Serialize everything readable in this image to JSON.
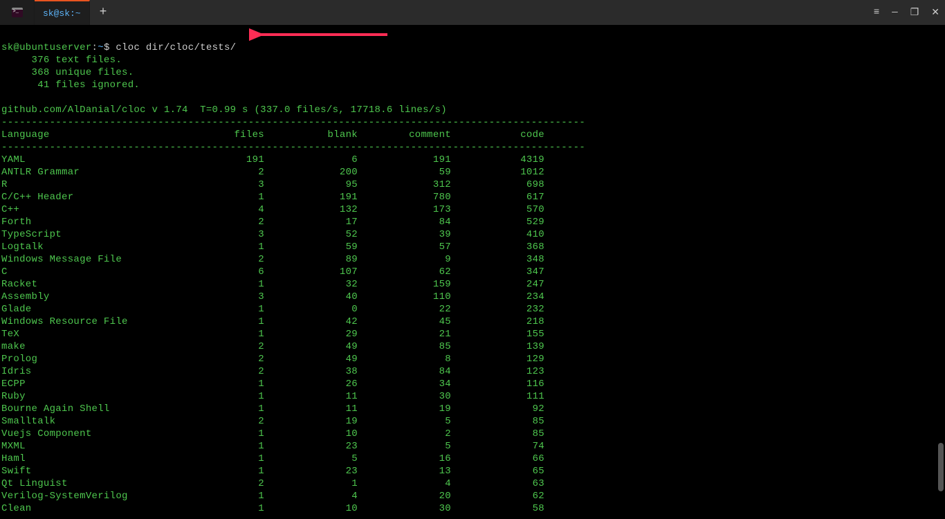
{
  "titlebar": {
    "tab_title": "sk@sk:~",
    "add_label": "+",
    "hamburger": "≡",
    "minimize": "—",
    "maximize": "❐",
    "close": "✕"
  },
  "prompt": {
    "user": "sk@ubuntuserver",
    "colon": ":",
    "path": "~",
    "dollar": "$"
  },
  "command": "cloc dir/cloc/tests/",
  "output_lines": [
    "     376 text files.",
    "     368 unique files.",
    "      41 files ignored."
  ],
  "version_line": "github.com/AlDanial/cloc v 1.74  T=0.99 s (337.0 files/s, 17718.6 lines/s)",
  "dashes": "-------------------------------------------------------------------------------------------------",
  "header": {
    "lang": "Language",
    "files": "files",
    "blank": "blank",
    "comment": "comment",
    "code": "code"
  },
  "chart_data": {
    "type": "table",
    "columns": [
      "Language",
      "files",
      "blank",
      "comment",
      "code"
    ],
    "rows": [
      {
        "lang": "YAML",
        "files": 191,
        "blank": 6,
        "comment": 191,
        "code": 4319
      },
      {
        "lang": "ANTLR Grammar",
        "files": 2,
        "blank": 200,
        "comment": 59,
        "code": 1012
      },
      {
        "lang": "R",
        "files": 3,
        "blank": 95,
        "comment": 312,
        "code": 698
      },
      {
        "lang": "C/C++ Header",
        "files": 1,
        "blank": 191,
        "comment": 780,
        "code": 617
      },
      {
        "lang": "C++",
        "files": 4,
        "blank": 132,
        "comment": 173,
        "code": 570
      },
      {
        "lang": "Forth",
        "files": 2,
        "blank": 17,
        "comment": 84,
        "code": 529
      },
      {
        "lang": "TypeScript",
        "files": 3,
        "blank": 52,
        "comment": 39,
        "code": 410
      },
      {
        "lang": "Logtalk",
        "files": 1,
        "blank": 59,
        "comment": 57,
        "code": 368
      },
      {
        "lang": "Windows Message File",
        "files": 2,
        "blank": 89,
        "comment": 9,
        "code": 348
      },
      {
        "lang": "C",
        "files": 6,
        "blank": 107,
        "comment": 62,
        "code": 347
      },
      {
        "lang": "Racket",
        "files": 1,
        "blank": 32,
        "comment": 159,
        "code": 247
      },
      {
        "lang": "Assembly",
        "files": 3,
        "blank": 40,
        "comment": 110,
        "code": 234
      },
      {
        "lang": "Glade",
        "files": 1,
        "blank": 0,
        "comment": 22,
        "code": 232
      },
      {
        "lang": "Windows Resource File",
        "files": 1,
        "blank": 42,
        "comment": 45,
        "code": 218
      },
      {
        "lang": "TeX",
        "files": 1,
        "blank": 29,
        "comment": 21,
        "code": 155
      },
      {
        "lang": "make",
        "files": 2,
        "blank": 49,
        "comment": 85,
        "code": 139
      },
      {
        "lang": "Prolog",
        "files": 2,
        "blank": 49,
        "comment": 8,
        "code": 129
      },
      {
        "lang": "Idris",
        "files": 2,
        "blank": 38,
        "comment": 84,
        "code": 123
      },
      {
        "lang": "ECPP",
        "files": 1,
        "blank": 26,
        "comment": 34,
        "code": 116
      },
      {
        "lang": "Ruby",
        "files": 1,
        "blank": 11,
        "comment": 30,
        "code": 111
      },
      {
        "lang": "Bourne Again Shell",
        "files": 1,
        "blank": 11,
        "comment": 19,
        "code": 92
      },
      {
        "lang": "Smalltalk",
        "files": 2,
        "blank": 19,
        "comment": 5,
        "code": 85
      },
      {
        "lang": "Vuejs Component",
        "files": 1,
        "blank": 10,
        "comment": 2,
        "code": 85
      },
      {
        "lang": "MXML",
        "files": 1,
        "blank": 23,
        "comment": 5,
        "code": 74
      },
      {
        "lang": "Haml",
        "files": 1,
        "blank": 5,
        "comment": 16,
        "code": 66
      },
      {
        "lang": "Swift",
        "files": 1,
        "blank": 23,
        "comment": 13,
        "code": 65
      },
      {
        "lang": "Qt Linguist",
        "files": 2,
        "blank": 1,
        "comment": 4,
        "code": 63
      },
      {
        "lang": "Verilog-SystemVerilog",
        "files": 1,
        "blank": 4,
        "comment": 20,
        "code": 62
      },
      {
        "lang": "Clean",
        "files": 1,
        "blank": 10,
        "comment": 30,
        "code": 58
      }
    ]
  }
}
